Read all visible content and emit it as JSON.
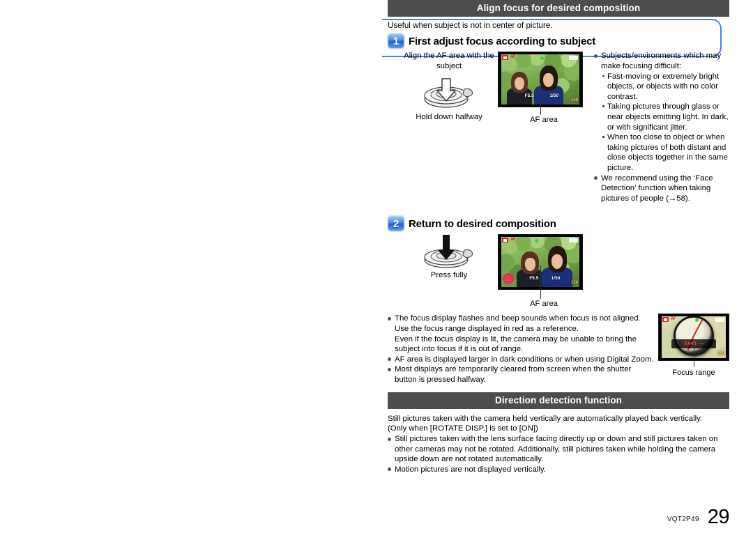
{
  "document": {
    "footer_code": "VQT2P49",
    "page_number": "29"
  },
  "section1": {
    "title": "Align focus for desired composition",
    "lead": "Useful when subject is not in center of picture.",
    "step1": {
      "badge": "1",
      "title": "First adjust focus according to subject",
      "caption_top": "Align the AF area with the subject",
      "caption_bottom": "Hold down halfway",
      "af_label": "AF area",
      "camera_osd": {
        "af_mode": "AF",
        "aperture": "F5.5",
        "shutter": "1/50",
        "counter": "150"
      }
    },
    "notes_right": [
      {
        "text": "Subjects/environments which may make focusing difficult:",
        "sub": [
          "Fast-moving or extremely bright objects, or objects with no color contrast.",
          "Taking pictures through glass or near objects emitting light. In dark, or with significant jitter.",
          "When too close to object or when taking pictures of both distant and close objects together in the same picture."
        ]
      },
      {
        "text": "We recommend using the ‘Face Detection’ function when taking pictures of people (→58).",
        "sub": []
      }
    ],
    "step2": {
      "badge": "2",
      "title": "Return to desired composition",
      "caption_bottom": "Press fully",
      "af_label": "AF area",
      "camera_osd": {
        "af_mode": "AF",
        "aperture": "F5.5",
        "shutter": "1/50",
        "counter": "150"
      }
    },
    "notes_bottom": [
      "The focus display flashes and beep sounds when focus is not aligned.",
      "AF area is displayed larger in dark conditions or when using Digital Zoom.",
      "Most displays are temporarily cleared from screen when the shutter button is pressed halfway."
    ],
    "notes_bottom_extra": [
      "Use the focus range displayed in red as a reference.",
      "Even if the focus display is lit, the camera may be unable to bring the subject into focus if it is out of range."
    ],
    "focus_figure": {
      "caption": "Focus range",
      "range_text": "0.64ft - ∞"
    }
  },
  "section2": {
    "title": "Direction detection function",
    "paragraph_line1": "Still pictures taken with the camera held vertically are automatically played back vertically.",
    "paragraph_line2": "(Only when [ROTATE DISP.] is set to [ON])",
    "notes": [
      "Still pictures taken with the lens surface facing directly up or down and still pictures taken on other cameras may not be rotated. Additionally, still pictures taken while holding the camera upside down are not rotated automatically.",
      "Motion pictures are not displayed vertically."
    ]
  },
  "colors": {
    "accent_blue": "#4a7dfa",
    "section_bar": "#4d4d4d",
    "osd_red": "#d6232a",
    "focus_red": "#ff3b30"
  }
}
